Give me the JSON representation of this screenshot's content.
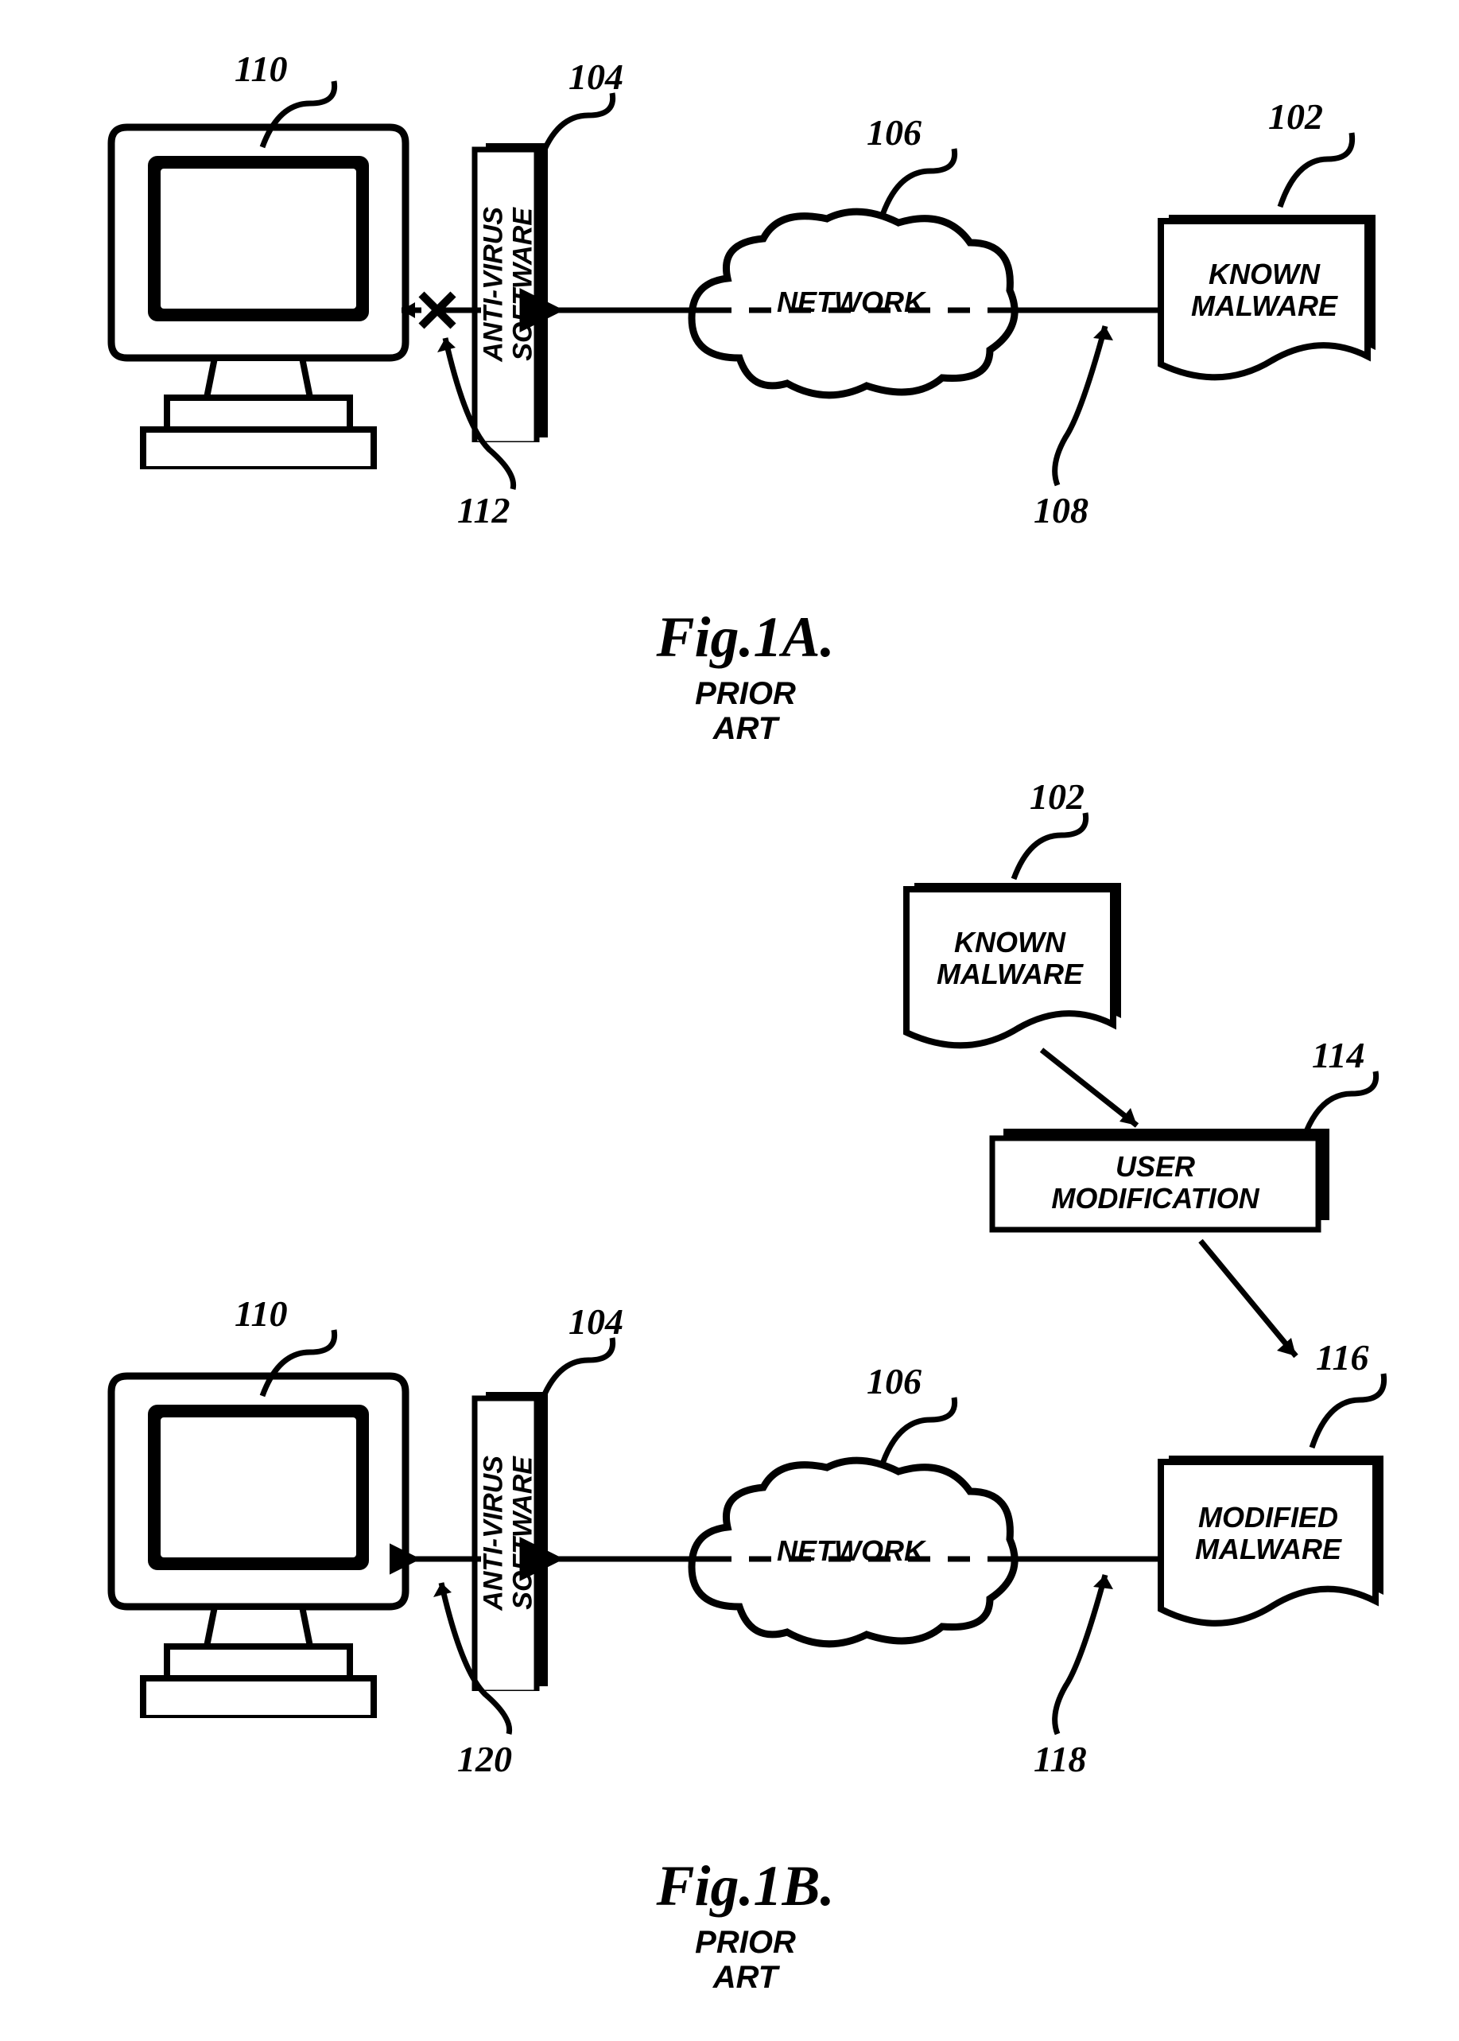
{
  "figA": {
    "title": "Fig.1A.",
    "subtitle1": "PRIOR",
    "subtitle2": "ART",
    "refs": {
      "r110": "110",
      "r104": "104",
      "r106": "106",
      "r102": "102",
      "r112": "112",
      "r108": "108"
    },
    "nodes": {
      "antivirus_l1": "ANTI-VIRUS",
      "antivirus_l2": "SOFTWARE",
      "network": "NETWORK",
      "known_l1": "KNOWN",
      "known_l2": "MALWARE"
    }
  },
  "figB": {
    "title": "Fig.1B.",
    "subtitle1": "PRIOR",
    "subtitle2": "ART",
    "refs": {
      "r102": "102",
      "r114": "114",
      "r110": "110",
      "r104": "104",
      "r106": "106",
      "r116": "116",
      "r120": "120",
      "r118": "118"
    },
    "nodes": {
      "known_l1": "KNOWN",
      "known_l2": "MALWARE",
      "usermod_l1": "USER",
      "usermod_l2": "MODIFICATION",
      "antivirus_l1": "ANTI-VIRUS",
      "antivirus_l2": "SOFTWARE",
      "network": "NETWORK",
      "modified_l1": "MODIFIED",
      "modified_l2": "MALWARE"
    }
  }
}
